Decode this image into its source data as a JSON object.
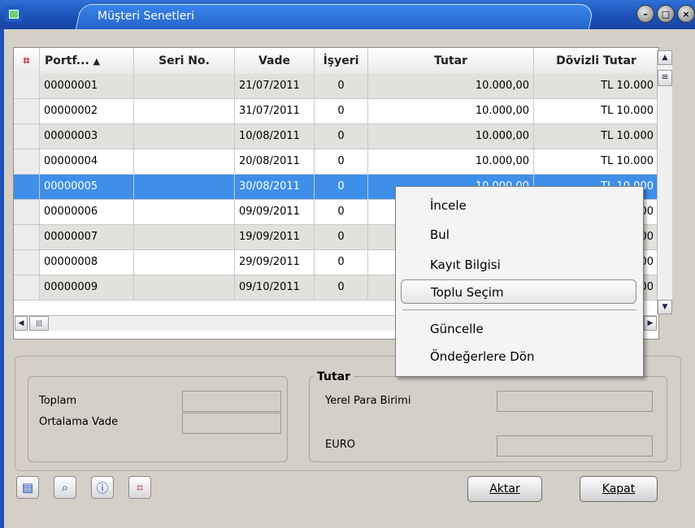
{
  "window": {
    "title": "Müşteri Senetleri"
  },
  "grid": {
    "columns": [
      "Portf...",
      "Seri No.",
      "Vade",
      "İşyeri",
      "Tutar",
      "Dövizli Tutar"
    ],
    "sort_glyph": "▲",
    "rows": [
      {
        "portfoy": "00000001",
        "seri": "",
        "vade": "21/07/2011",
        "isyeri": "0",
        "tutar": "10.000,00",
        "doviz": "TL 10.000"
      },
      {
        "portfoy": "00000002",
        "seri": "",
        "vade": "31/07/2011",
        "isyeri": "0",
        "tutar": "10.000,00",
        "doviz": "TL 10.000"
      },
      {
        "portfoy": "00000003",
        "seri": "",
        "vade": "10/08/2011",
        "isyeri": "0",
        "tutar": "10.000,00",
        "doviz": "TL 10.000"
      },
      {
        "portfoy": "00000004",
        "seri": "",
        "vade": "20/08/2011",
        "isyeri": "0",
        "tutar": "10.000,00",
        "doviz": "TL 10.000"
      },
      {
        "portfoy": "00000005",
        "seri": "",
        "vade": "30/08/2011",
        "isyeri": "0",
        "tutar": "10.000,00",
        "doviz": "TL 10.000"
      },
      {
        "portfoy": "00000006",
        "seri": "",
        "vade": "09/09/2011",
        "isyeri": "0",
        "tutar": "",
        "doviz": "00"
      },
      {
        "portfoy": "00000007",
        "seri": "",
        "vade": "19/09/2011",
        "isyeri": "0",
        "tutar": "",
        "doviz": "00"
      },
      {
        "portfoy": "00000008",
        "seri": "",
        "vade": "29/09/2011",
        "isyeri": "0",
        "tutar": "",
        "doviz": "00"
      },
      {
        "portfoy": "00000009",
        "seri": "",
        "vade": "09/10/2011",
        "isyeri": "0",
        "tutar": "",
        "doviz": "00"
      }
    ],
    "selected_row": "00000005"
  },
  "context_menu": {
    "items": [
      "İncele",
      "Bul",
      "Kayıt Bilgisi",
      "Toplu Seçim",
      "Güncelle",
      "Öndeğerlere Dön"
    ],
    "highlighted": "Toplu Seçim"
  },
  "summary": {
    "toplam_label": "Toplam",
    "ortalama_label": "Ortalama Vade",
    "tutar_group": "Tutar",
    "yerel_label": "Yerel Para Birimi",
    "euro_label": "EURO"
  },
  "buttons": {
    "aktar": "Aktar",
    "kapat": "Kapat"
  },
  "colors": {
    "selection": "#3d8fea",
    "titlebar": "#1a4fb8"
  }
}
